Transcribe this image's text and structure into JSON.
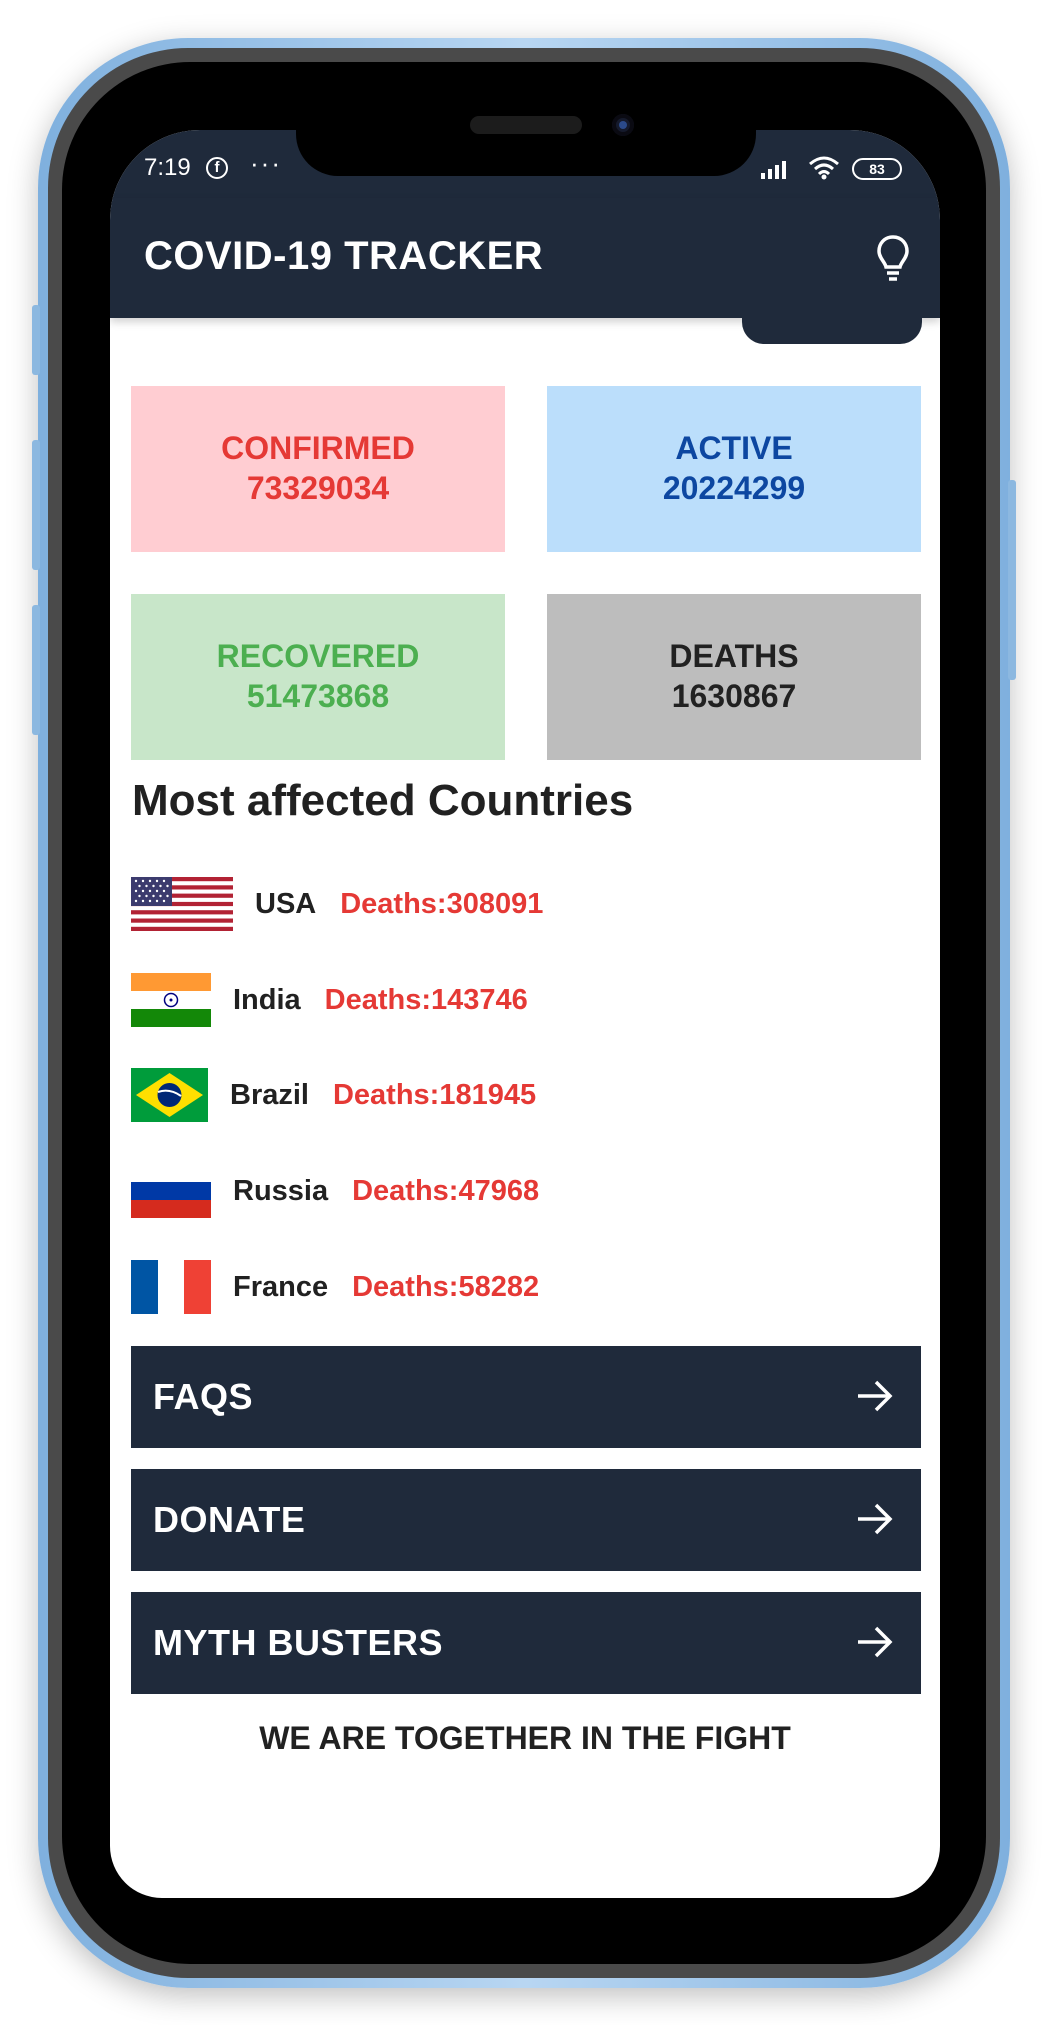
{
  "status_bar": {
    "time": "7:19",
    "facebook_glyph": "f",
    "overflow": "···",
    "battery": "83"
  },
  "app_bar": {
    "title": "COVID-19 TRACKER",
    "action_icon": "lightbulb-icon"
  },
  "stats": {
    "confirmed": {
      "label": "CONFIRMED",
      "value": "73329034",
      "color": "#e53935",
      "bg": "#ffcdd2"
    },
    "active": {
      "label": "ACTIVE",
      "value": "20224299",
      "color": "#0d47a1",
      "bg": "#bbdefb"
    },
    "recovered": {
      "label": "RECOVERED",
      "value": "51473868",
      "color": "#4caf50",
      "bg": "#c8e6c9"
    },
    "deaths": {
      "label": "DEATHS",
      "value": "1630867",
      "color": "#212121",
      "bg": "#bdbdbd"
    }
  },
  "countries_section": {
    "title": "Most affected Countries",
    "countries": [
      {
        "name": "USA",
        "deaths": "Deaths:308091",
        "flag": "usa-flag"
      },
      {
        "name": "India",
        "deaths": "Deaths:143746",
        "flag": "india-flag"
      },
      {
        "name": "Brazil",
        "deaths": "Deaths:181945",
        "flag": "brazil-flag"
      },
      {
        "name": "Russia",
        "deaths": "Deaths:47968",
        "flag": "russia-flag"
      },
      {
        "name": "France",
        "deaths": "Deaths:58282",
        "flag": "france-flag"
      }
    ]
  },
  "nav": [
    {
      "label": "FAQS",
      "icon": "arrow-right-icon"
    },
    {
      "label": "DONATE",
      "icon": "arrow-right-icon"
    },
    {
      "label": "MYTH BUSTERS",
      "icon": "arrow-right-icon"
    }
  ],
  "footer": {
    "text": "WE ARE TOGETHER IN THE FIGHT"
  },
  "colors": {
    "appbar": "#1f2a3b",
    "accent_red": "#e53935"
  }
}
